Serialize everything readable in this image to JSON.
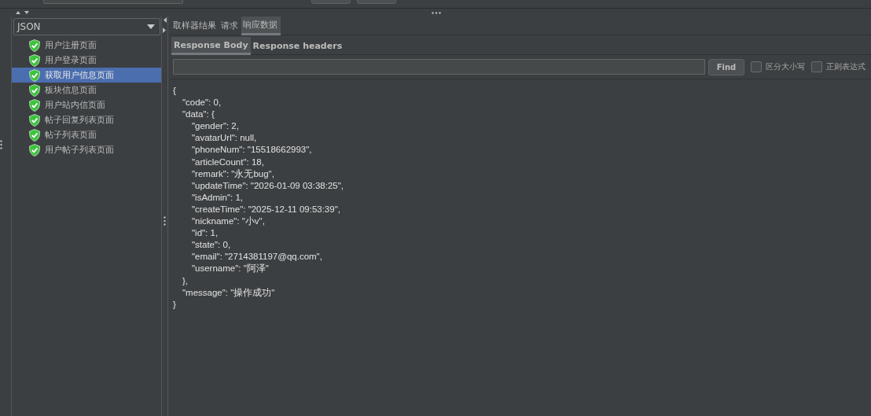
{
  "selector": {
    "value": "JSON"
  },
  "results": [
    {
      "label": "用户注册页面",
      "kind": "success",
      "selected": false
    },
    {
      "label": "用户登录页面",
      "kind": "success",
      "selected": false
    },
    {
      "label": "获取用户信息页面",
      "kind": "success",
      "selected": true
    },
    {
      "label": "板块信息页面",
      "kind": "success",
      "selected": false
    },
    {
      "label": "用户站内信页面",
      "kind": "success",
      "selected": false
    },
    {
      "label": "帖子回复列表页面",
      "kind": "success",
      "selected": false
    },
    {
      "label": "帖子列表页面",
      "kind": "success",
      "selected": false
    },
    {
      "label": "用户帖子列表页面",
      "kind": "success",
      "selected": false
    }
  ],
  "tabs": [
    {
      "label": "取样器结果",
      "selected": false
    },
    {
      "label": "请求",
      "selected": false
    },
    {
      "label": "响应数据",
      "selected": true
    }
  ],
  "subtabs": [
    {
      "label": "Response Body",
      "selected": true
    },
    {
      "label": "Response headers",
      "selected": false
    }
  ],
  "search": {
    "button": "Find",
    "options": [
      {
        "label": "区分大小写",
        "checked": false
      },
      {
        "label": "正则表达式",
        "checked": false
      }
    ]
  },
  "body": "{\n\t\"code\": 0,\n\t\"data\": {\n\t\t\"gender\": 2,\n\t\t\"avatarUrl\": null,\n\t\t\"phoneNum\": \"15518662993\",\n\t\t\"articleCount\": 18,\n\t\t\"remark\": \"永无bug\",\n\t\t\"updateTime\": \"2026-01-09 03:38:25\",\n\t\t\"isAdmin\": 1,\n\t\t\"createTime\": \"2025-12-11 09:53:39\",\n\t\t\"nickname\": \"小v\",\n\t\t\"id\": 1,\n\t\t\"state\": 0,\n\t\t\"email\": \"2714381197@qq.com\",\n\t\t\"username\": \"阿泽\"\n\t},\n\t\"message\": \"操作成功\"\n}"
}
